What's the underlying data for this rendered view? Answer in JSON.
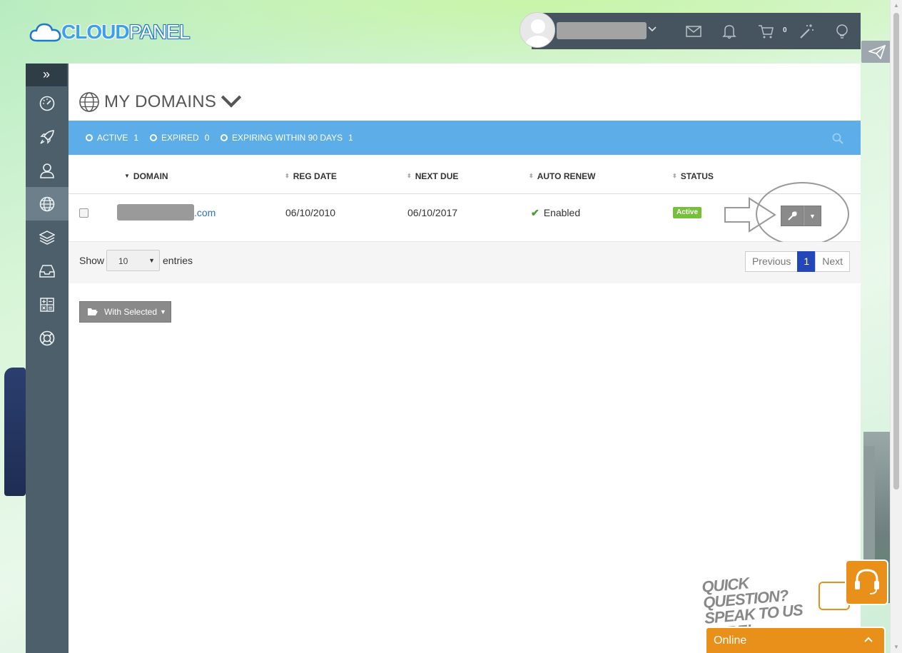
{
  "brand": {
    "logo_bold": "CLOUD",
    "logo_light": "PANEL"
  },
  "topbar": {
    "icons": [
      "user-avatar",
      "chevron-down-icon",
      "mail-icon",
      "bell-icon",
      "cart-icon",
      "magic-wand-icon",
      "lightbulb-icon"
    ],
    "cart_count": "0"
  },
  "sidebar": {
    "items": [
      {
        "icon": "dashboard-icon",
        "active": false
      },
      {
        "icon": "rocket-icon",
        "active": false
      },
      {
        "icon": "user-icon",
        "active": false
      },
      {
        "icon": "globe-icon",
        "active": true
      },
      {
        "icon": "layers-icon",
        "active": false
      },
      {
        "icon": "inbox-icon",
        "active": false
      },
      {
        "icon": "calculator-icon",
        "active": false
      },
      {
        "icon": "lifebuoy-icon",
        "active": false
      }
    ]
  },
  "page": {
    "title": "MY DOMAINS"
  },
  "filters": [
    {
      "label": "ACTIVE",
      "count": "1"
    },
    {
      "label": "EXPIRED",
      "count": "0"
    },
    {
      "label": "EXPIRING WITHIN 90 DAYS",
      "count": "1"
    }
  ],
  "table": {
    "columns": [
      "DOMAIN",
      "REG DATE",
      "NEXT DUE",
      "AUTO RENEW",
      "STATUS"
    ],
    "rows": [
      {
        "domain_suffix": ".com",
        "reg_date": "06/10/2010",
        "next_due": "06/10/2017",
        "auto_renew": "Enabled",
        "status": "Active"
      }
    ]
  },
  "pagination": {
    "show_label": "Show",
    "entries_value": "10",
    "entries_label": "entries",
    "previous": "Previous",
    "current": "1",
    "next": "Next"
  },
  "bulk": {
    "with_selected": "With Selected"
  },
  "chat": {
    "banner_line1": "QUICK QUESTION?",
    "banner_line2": "SPEAK TO US HERE!",
    "status": "Online"
  },
  "colors": {
    "accent_blue": "#5dade8",
    "sidebar": "#4d5f6a",
    "topbar": "#45545f",
    "active_badge": "#76bf3a",
    "chat_orange": "#e8901a",
    "pager_active": "#2346b8"
  }
}
